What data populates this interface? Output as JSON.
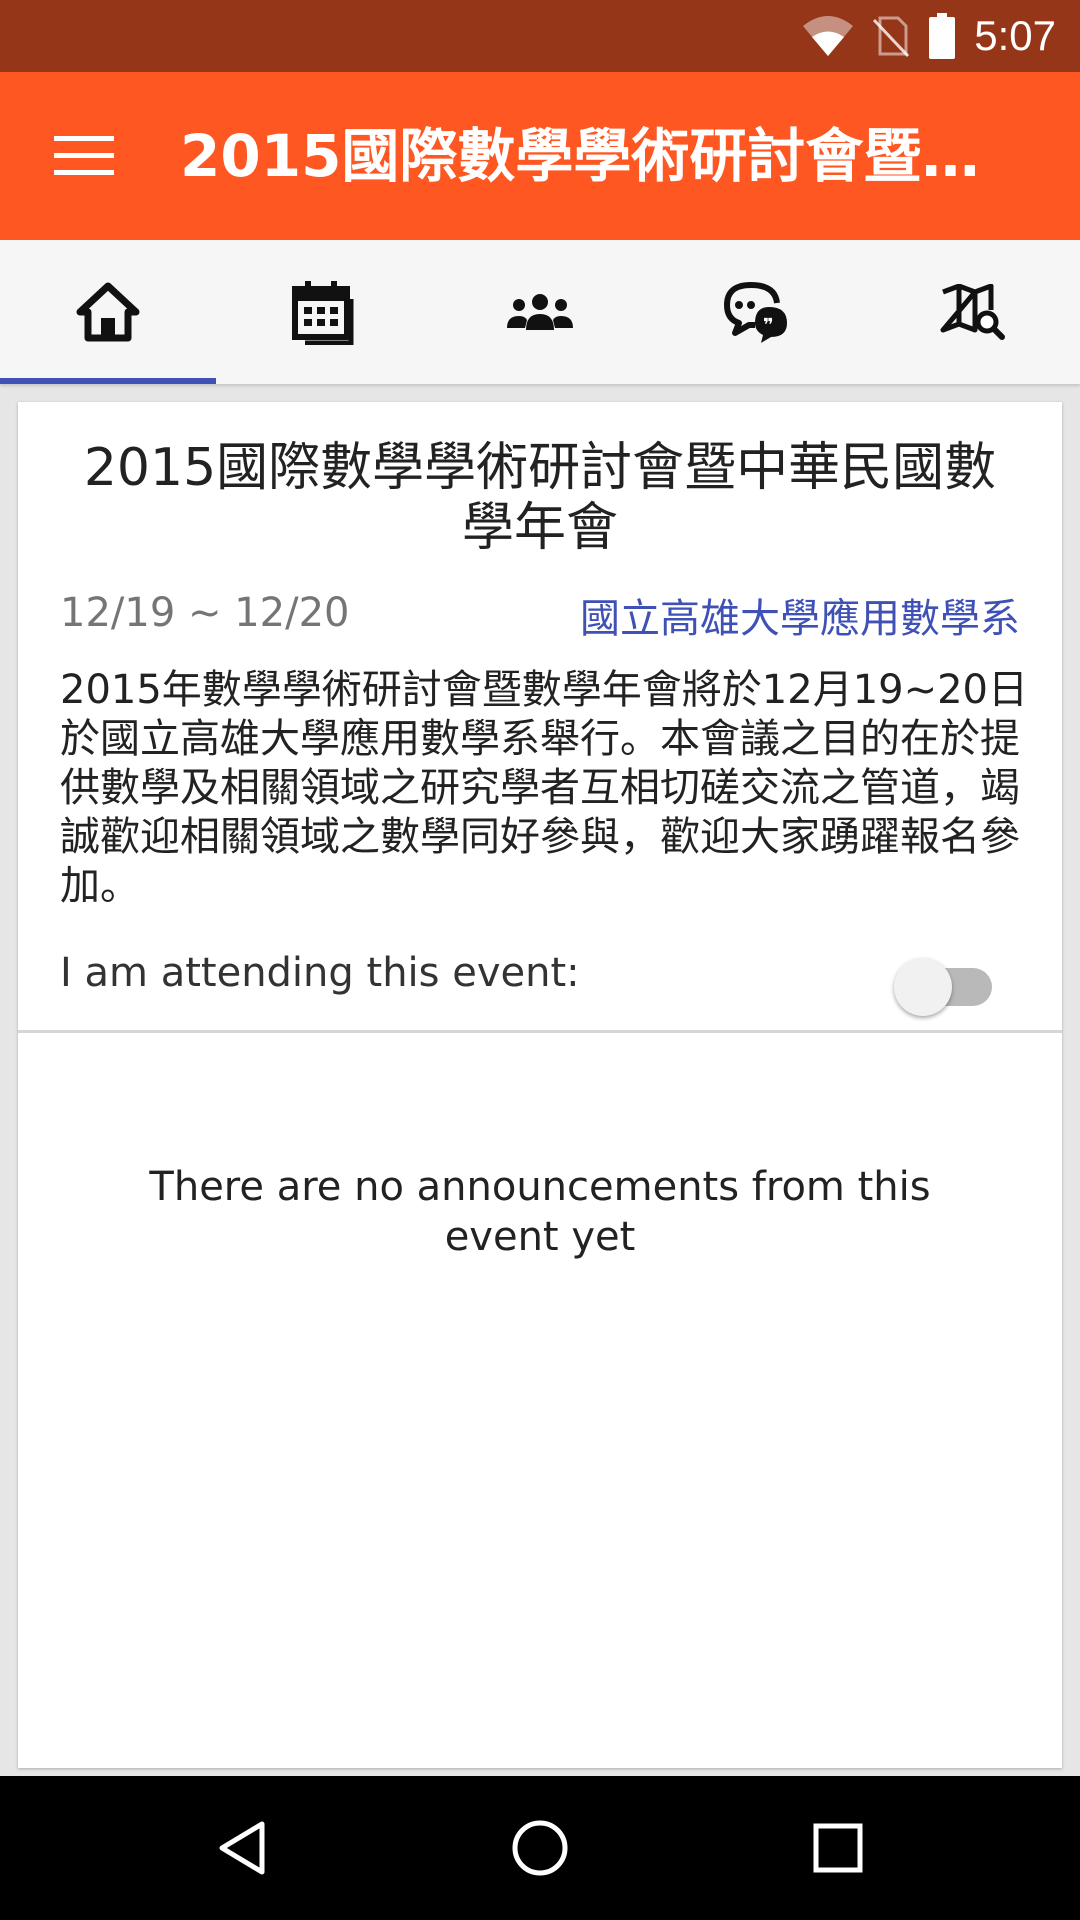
{
  "status_bar": {
    "time": "5:07",
    "icons": [
      "wifi-icon",
      "no-sim-icon",
      "battery-icon"
    ]
  },
  "app_bar": {
    "title": "2015國際數學學術研討會暨中華民國數學年會",
    "menu_icon": "menu-icon",
    "background": "#fe5722"
  },
  "tabs": [
    {
      "icon": "home-icon",
      "selected": true
    },
    {
      "icon": "calendar-icon",
      "selected": false
    },
    {
      "icon": "people-icon",
      "selected": false
    },
    {
      "icon": "chat-icon",
      "selected": false
    },
    {
      "icon": "map-search-icon",
      "selected": false
    }
  ],
  "event": {
    "title": "2015國際數學學術研討會暨中華民國數學年會",
    "date_range": "12/19 ~ 12/20",
    "host": "國立高雄大學應用數學系",
    "description": "2015年數學學術研討會暨數學年會將於12月19~20日於國立高雄大學應用數學系舉行。本會議之目的在於提供數學及相關領域之研究學者互相切磋交流之管道，竭誠歡迎相關領域之數學同好參與，歡迎大家踴躍報名參加。",
    "attending_label": "I am attending this event:",
    "attending": false
  },
  "announcements": {
    "empty_message": "There are no announcements from this event yet"
  },
  "nav_bar": {
    "buttons": [
      "back-icon",
      "home-icon",
      "recents-icon"
    ]
  },
  "colors": {
    "status_bar": "#963618",
    "accent": "#3f51b5"
  }
}
